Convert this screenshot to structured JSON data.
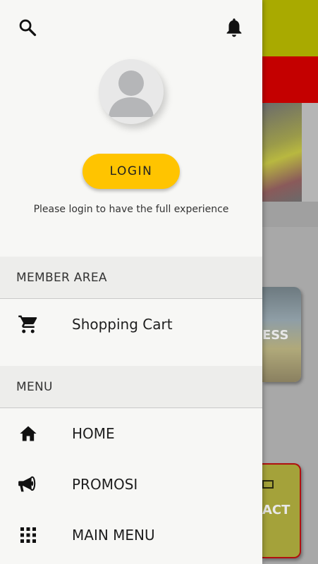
{
  "drawer": {
    "search_icon": "search-icon",
    "bell_icon": "bell-icon",
    "login_label": "LOGIN",
    "login_hint": "Please login to have the full experience",
    "member_area": {
      "title": "MEMBER AREA",
      "items": [
        {
          "label": "Shopping Cart",
          "icon": "cart-icon"
        }
      ]
    },
    "menu": {
      "title": "MENU",
      "items": [
        {
          "label": "HOME",
          "icon": "home-icon"
        },
        {
          "label": "PROMOSI",
          "icon": "megaphone-icon"
        },
        {
          "label": "MAIN MENU",
          "icon": "grid-icon"
        }
      ]
    }
  },
  "background": {
    "card1_text": "ESS",
    "card2_text": "ACT"
  },
  "colors": {
    "login_button": "#ffc400",
    "drawer_bg": "#f7f7f5",
    "section_header_bg": "#ededeb"
  }
}
